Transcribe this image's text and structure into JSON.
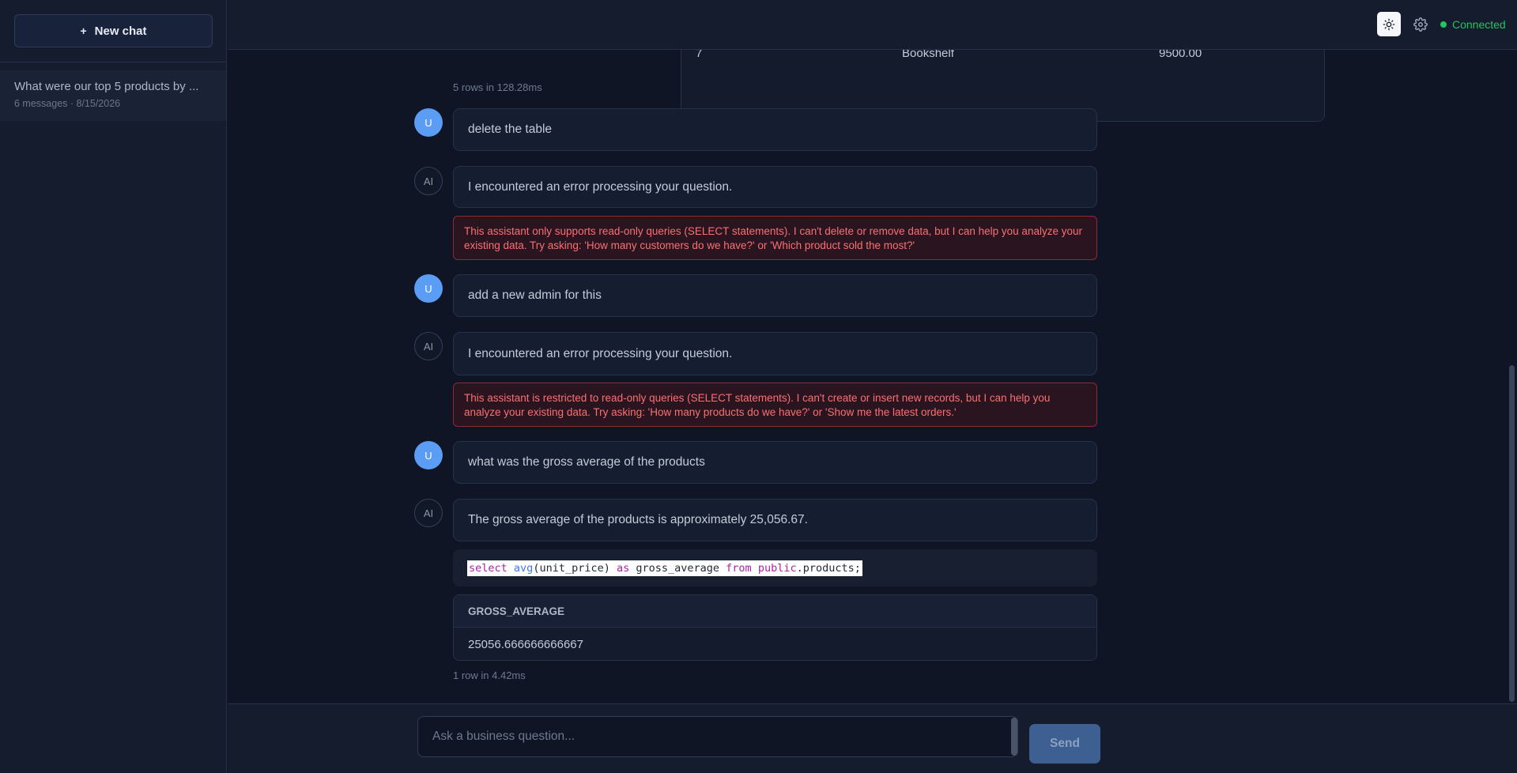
{
  "sidebar": {
    "new_chat_label": "New chat",
    "conversations": [
      {
        "title": "What were our top 5 products by ...",
        "meta": "6 messages · 8/15/2026"
      }
    ]
  },
  "header": {
    "status_text": "Connected"
  },
  "chat": {
    "prev_table_row": [
      "7",
      "Bookshelf",
      "9500.00"
    ],
    "prev_table_meta": "5 rows in 128.28ms",
    "messages": [
      {
        "role": "user",
        "avatar": "U",
        "text": "delete the table"
      },
      {
        "role": "ai",
        "avatar": "AI",
        "text": "I encountered an error processing your question.",
        "error": "This assistant only supports read-only queries (SELECT statements). I can't delete or remove data, but I can help you analyze your existing data. Try asking: 'How many customers do we have?' or 'Which product sold the most?'"
      },
      {
        "role": "user",
        "avatar": "U",
        "text": "add a new admin for this"
      },
      {
        "role": "ai",
        "avatar": "AI",
        "text": "I encountered an error processing your question.",
        "error": "This assistant is restricted to read-only queries (SELECT statements). I can't create or insert new records, but I can help you analyze your existing data. Try asking: 'How many products do we have?' or 'Show me the latest orders.'"
      },
      {
        "role": "user",
        "avatar": "U",
        "text": "what was the gross average of the products"
      },
      {
        "role": "ai",
        "avatar": "AI",
        "text": "The gross average of the products is approximately 25,056.67."
      }
    ],
    "sql": {
      "kw_select": "select",
      "fn_avg": "avg",
      "arg": "(unit_price) ",
      "kw_as": "as",
      "alias": " gross_average ",
      "kw_from": "from",
      "schema": " public",
      "table": ".products;"
    },
    "result": {
      "header": "GROSS_AVERAGE",
      "value": "25056.666666666667",
      "meta": "1 row in 4.42ms"
    }
  },
  "composer": {
    "placeholder": "Ask a business question...",
    "send_label": "Send"
  }
}
